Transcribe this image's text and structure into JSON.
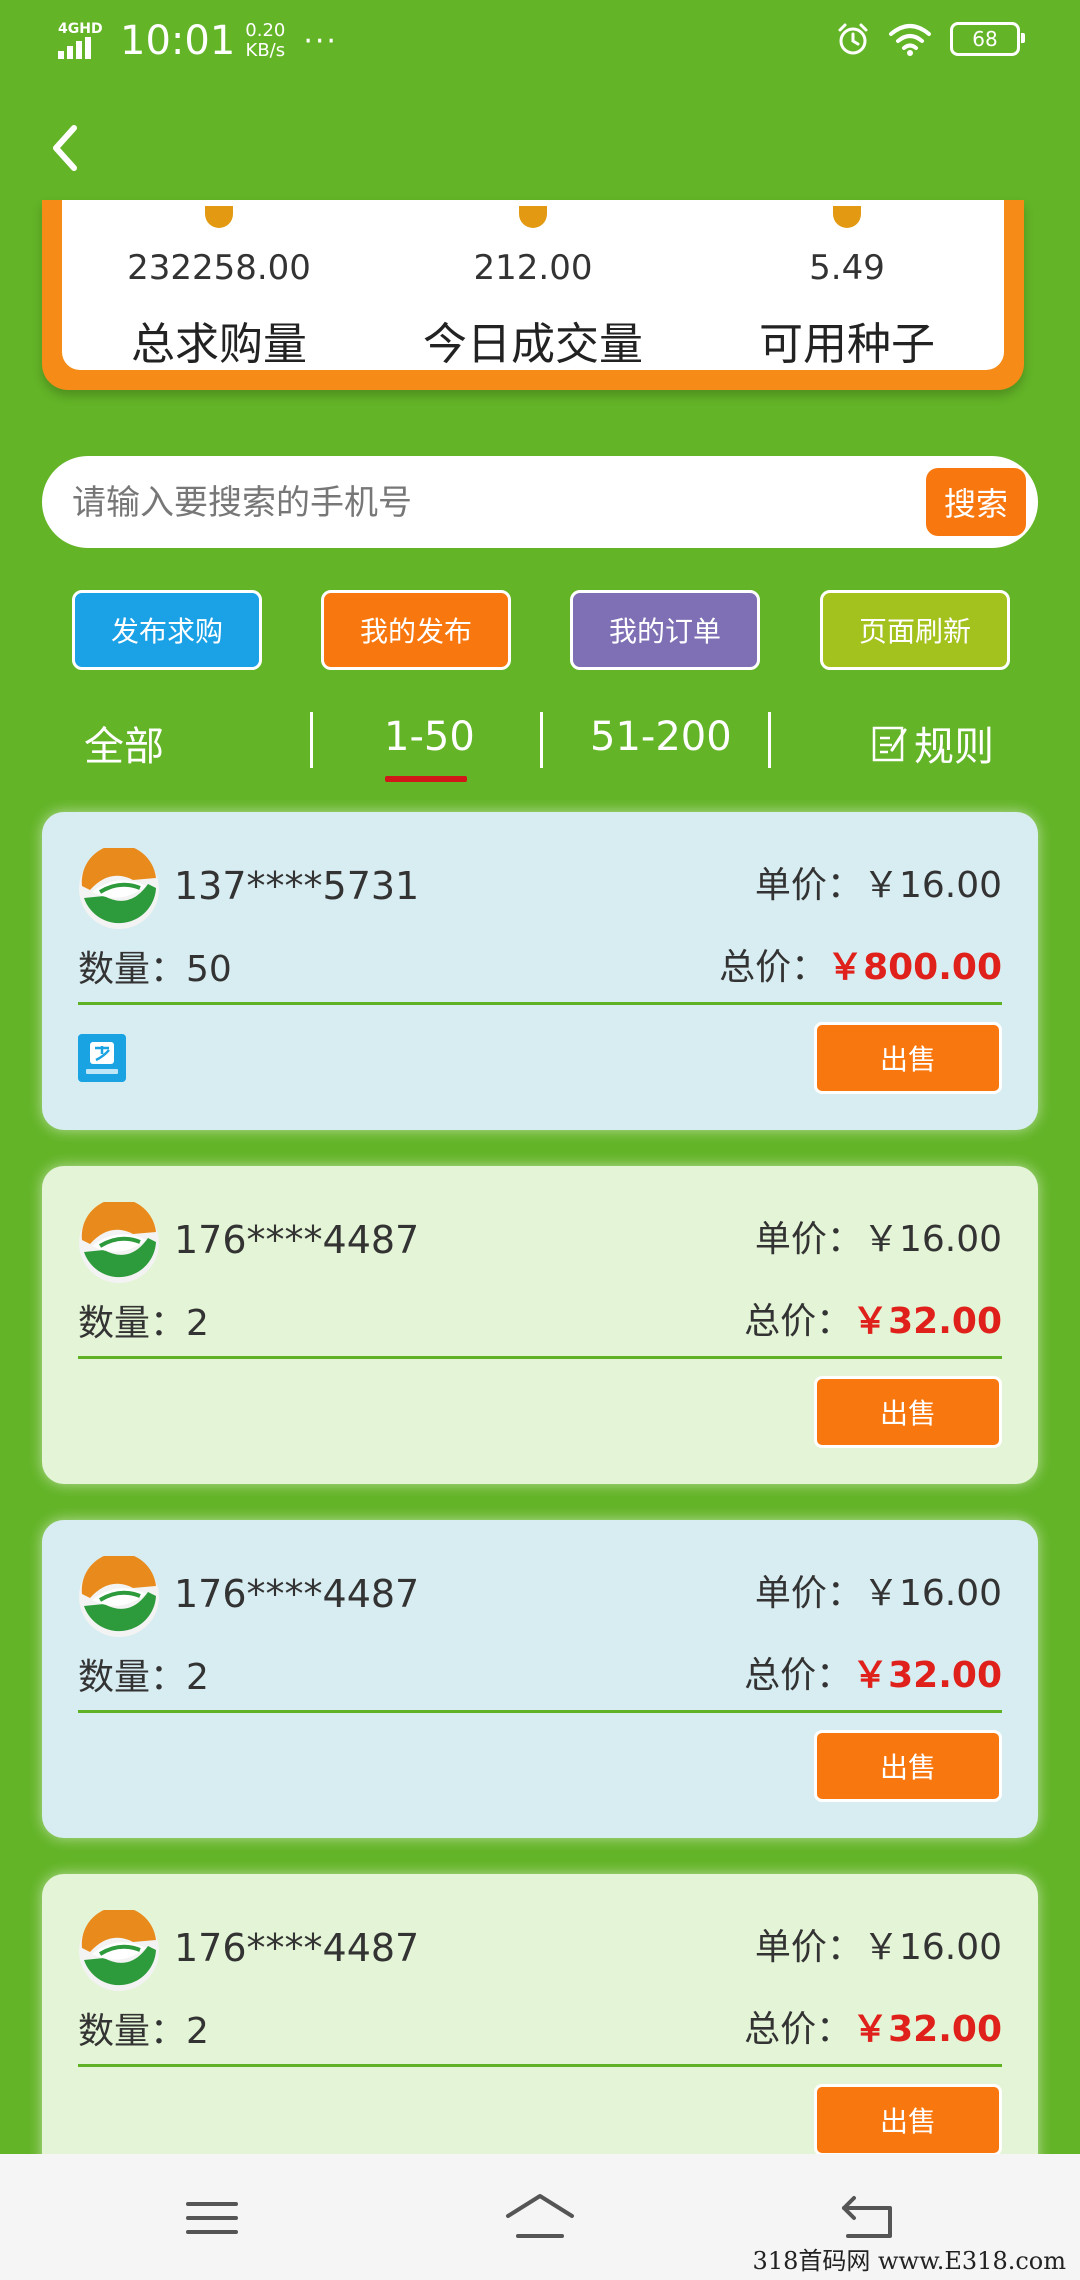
{
  "status_bar": {
    "network": "4GHD",
    "time": "10:01",
    "speed_value": "0.20",
    "speed_unit": "KB/s",
    "dots": "···",
    "battery": "68"
  },
  "summary": {
    "stats": [
      {
        "value": "232258.00",
        "label": "总求购量"
      },
      {
        "value": "212.00",
        "label": "今日成交量"
      },
      {
        "value": "5.49",
        "label": "可用种子"
      }
    ]
  },
  "search": {
    "placeholder": "请输入要搜索的手机号",
    "button_label": "搜索"
  },
  "actions": {
    "publish_request": "发布求购",
    "my_publish": "我的发布",
    "my_orders": "我的订单",
    "refresh": "页面刷新"
  },
  "filters": {
    "all": "全部",
    "range1": "1-50",
    "range2": "51-200",
    "rules": "规则",
    "selected": "1-50"
  },
  "orders": [
    {
      "phone": "137****5731",
      "unit_price_label": "单价：",
      "unit_price": "￥16.00",
      "qty_label": "数量：",
      "qty": "50",
      "total_label": "总价：",
      "total": "￥800.00",
      "sell_label": "出售",
      "alipay": true
    },
    {
      "phone": "176****4487",
      "unit_price_label": "单价：",
      "unit_price": "￥16.00",
      "qty_label": "数量：",
      "qty": "2",
      "total_label": "总价：",
      "total": "￥32.00",
      "sell_label": "出售",
      "alipay": false
    },
    {
      "phone": "176****4487",
      "unit_price_label": "单价：",
      "unit_price": "￥16.00",
      "qty_label": "数量：",
      "qty": "2",
      "total_label": "总价：",
      "total": "￥32.00",
      "sell_label": "出售",
      "alipay": false
    },
    {
      "phone": "176****4487",
      "unit_price_label": "单价：",
      "unit_price": "￥16.00",
      "qty_label": "数量：",
      "qty": "2",
      "total_label": "总价：",
      "total": "￥32.00",
      "sell_label": "出售",
      "alipay": false
    }
  ],
  "watermark": "318首码网 www.E318.com",
  "colors": {
    "background": "#63b427",
    "accent_orange": "#f8770f",
    "blue": "#1aa1e6",
    "purple": "#7f70b5",
    "lime": "#a4c21d",
    "price_red": "#e0201a"
  }
}
